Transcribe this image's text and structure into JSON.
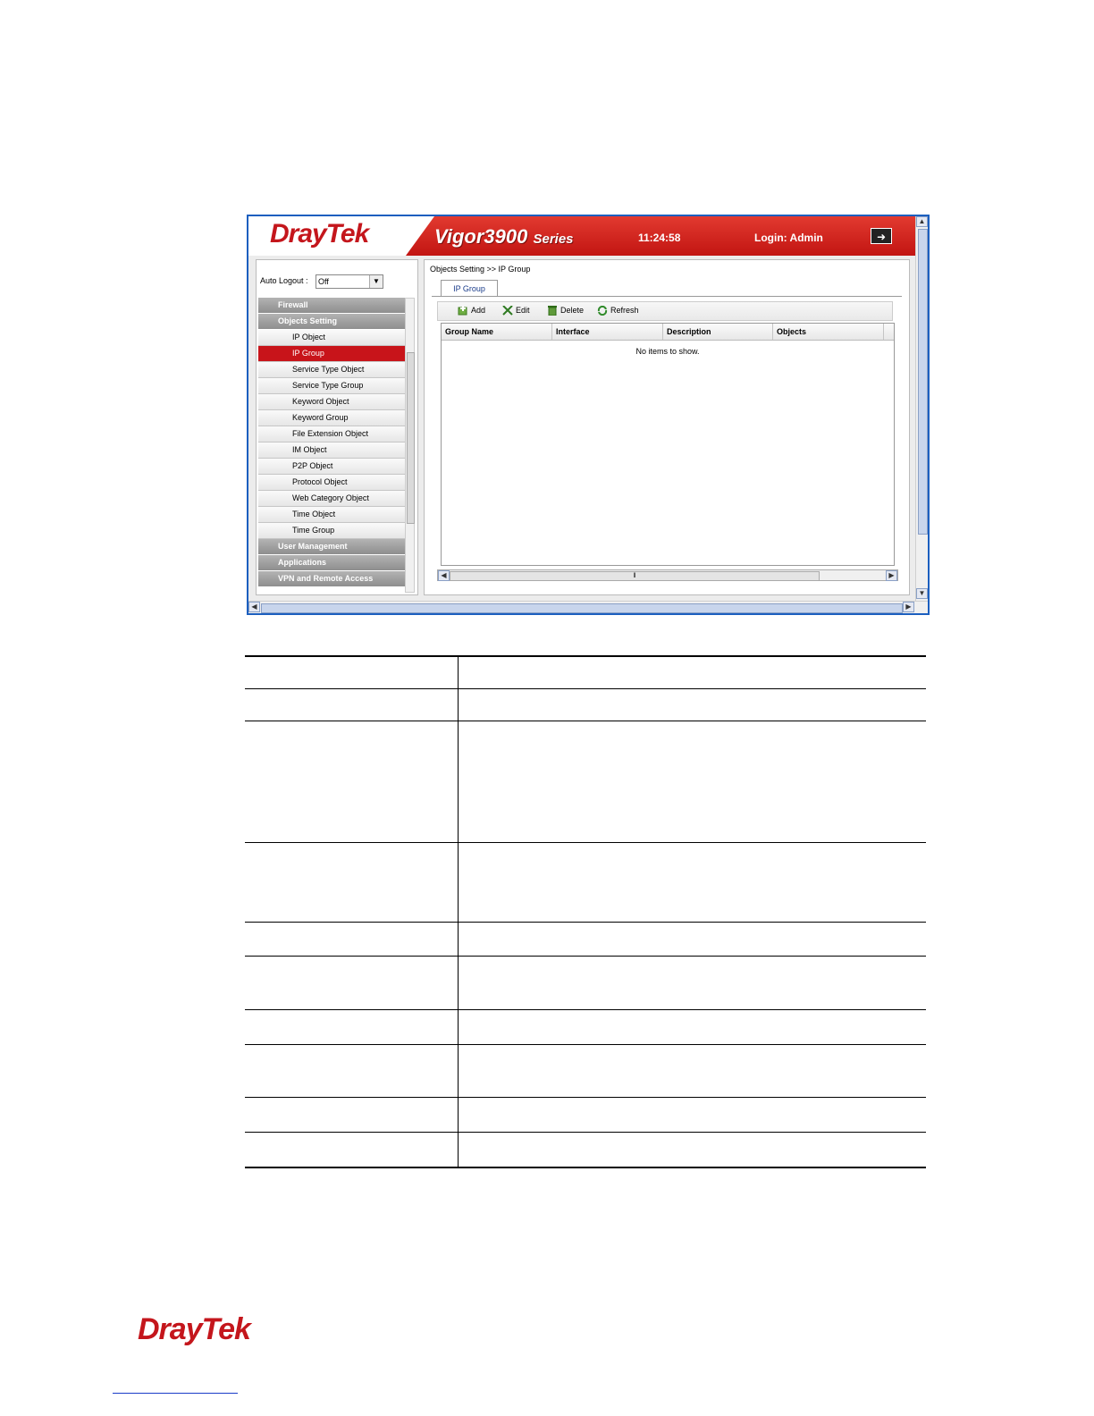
{
  "header": {
    "logo_dray": "Dray",
    "logo_tek": "Tek",
    "product_name": "Vigor3900",
    "product_series": "Series",
    "clock": "11:24:58",
    "login": "Login: Admin"
  },
  "sidebar": {
    "auto_logout_label": "Auto Logout :",
    "auto_logout_value": "Off",
    "items": [
      {
        "label": "Firewall"
      },
      {
        "label": "Objects Setting"
      },
      {
        "label": "IP Object"
      },
      {
        "label": "IP Group"
      },
      {
        "label": "Service Type Object"
      },
      {
        "label": "Service Type Group"
      },
      {
        "label": "Keyword Object"
      },
      {
        "label": "Keyword Group"
      },
      {
        "label": "File Extension Object"
      },
      {
        "label": "IM Object"
      },
      {
        "label": "P2P Object"
      },
      {
        "label": "Protocol Object"
      },
      {
        "label": "Web Category Object"
      },
      {
        "label": "Time Object"
      },
      {
        "label": "Time Group"
      },
      {
        "label": "User Management"
      },
      {
        "label": "Applications"
      },
      {
        "label": "VPN and Remote Access"
      }
    ]
  },
  "main": {
    "breadcrumb": "Objects Setting >> IP Group",
    "tab_label": "IP Group",
    "toolbar": {
      "add": "Add",
      "edit": "Edit",
      "delete": "Delete",
      "refresh": "Refresh"
    },
    "columns": [
      "Group Name",
      "Interface",
      "Description",
      "Objects"
    ],
    "empty_message": "No items to show."
  },
  "footer": {
    "logo_dray": "Dray",
    "logo_tek": "Tek"
  },
  "colors": {
    "brand_red": "#c4161c",
    "frame_blue": "#1c5fbf"
  }
}
